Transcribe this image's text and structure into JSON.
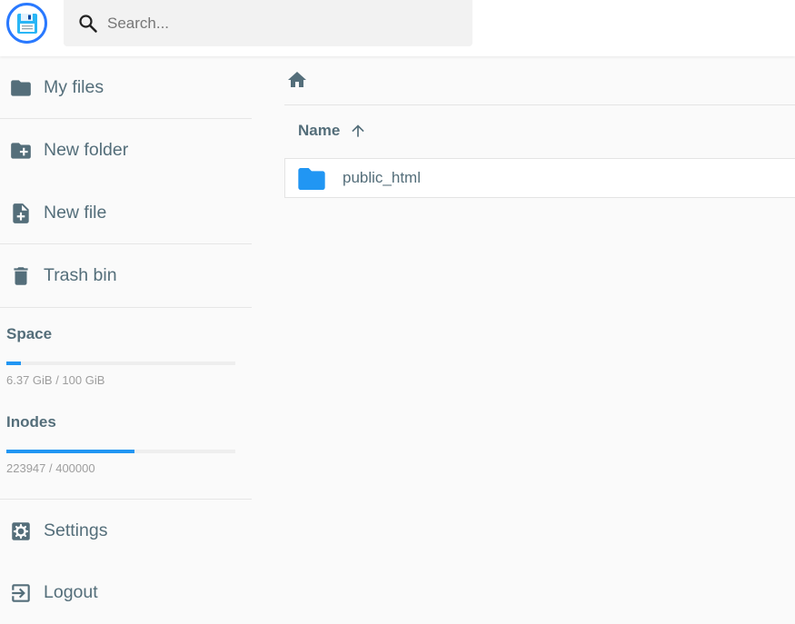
{
  "header": {
    "search": {
      "placeholder": "Search..."
    }
  },
  "sidebar": {
    "nav_top": [
      {
        "label": "My files",
        "icon": "folder-icon"
      },
      {
        "label": "New folder",
        "icon": "create-new-folder-icon"
      },
      {
        "label": "New file",
        "icon": "note-add-icon"
      },
      {
        "label": "Trash bin",
        "icon": "trash-icon"
      }
    ],
    "usage": {
      "space": {
        "title": "Space",
        "text": "6.37 GiB / 100 GiB",
        "fraction": 0.0637
      },
      "inodes": {
        "title": "Inodes",
        "text": "223947 / 400000",
        "fraction": 0.5599
      }
    },
    "nav_bottom": [
      {
        "label": "Settings",
        "icon": "settings-icon"
      },
      {
        "label": "Logout",
        "icon": "logout-icon"
      }
    ]
  },
  "main": {
    "column_header": {
      "label": "Name",
      "sort": "ascending"
    },
    "items": [
      {
        "name": "public_html",
        "type": "folder"
      }
    ]
  },
  "colors": {
    "accent": "#2196f3",
    "logo_ring": "#2979ff",
    "folder": "#2196f3",
    "icon": "#546e7a"
  }
}
